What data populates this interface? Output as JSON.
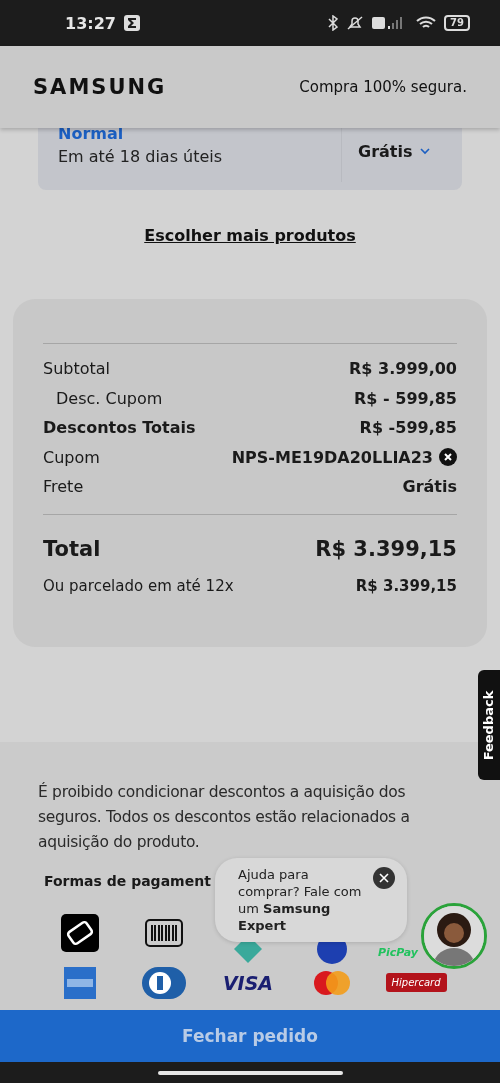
{
  "status_bar": {
    "time": "13:27",
    "battery": "79"
  },
  "header": {
    "logo": "SAMSUNG",
    "tagline": "Compra 100% segura."
  },
  "shipping": {
    "name": "Normal",
    "eta": "Em até 18 dias úteis",
    "price": "Grátis"
  },
  "more_link": "Escolher mais produtos",
  "summary": {
    "rows": [
      {
        "kind": "line",
        "label": "Subtotal",
        "value": "R$ 3.999,00"
      },
      {
        "kind": "sub",
        "label": "Desc. Cupom",
        "value": "R$ - 599,85"
      },
      {
        "kind": "strong",
        "label": "Descontos Totais",
        "value": "R$ -599,85"
      },
      {
        "kind": "coupon",
        "label": "Cupom",
        "value": "NPS-ME19DA20LLIA23"
      },
      {
        "kind": "line",
        "label": "Frete",
        "value": "Grátis"
      }
    ],
    "total": {
      "label": "Total",
      "value": "R$ 3.399,15"
    },
    "installments": {
      "label": "Ou parcelado em até 12x",
      "value": "R$ 3.399,15"
    }
  },
  "feedback_tab": "Feedback",
  "disclaimer": "É proibido condicionar descontos a aquisição dos seguros. Todos os descontos estão relacionados a aquisição do produto.",
  "payment": {
    "title": "Formas de pagament",
    "methods": [
      {
        "kind": "wallet"
      },
      {
        "kind": "boleto"
      },
      {
        "kind": "pix"
      },
      {
        "kind": "bank"
      },
      {
        "kind": "picpay",
        "label": "PicPay"
      },
      {
        "kind": "amex"
      },
      {
        "kind": "diners"
      },
      {
        "kind": "visa",
        "label": "VISA"
      },
      {
        "kind": "mastercard"
      },
      {
        "kind": "hipercard",
        "label": "Hipercard"
      }
    ]
  },
  "chat": {
    "text": "Ajuda para comprar? Fale com um **Samsung Expert**"
  },
  "checkout_button": "Fechar pedido"
}
